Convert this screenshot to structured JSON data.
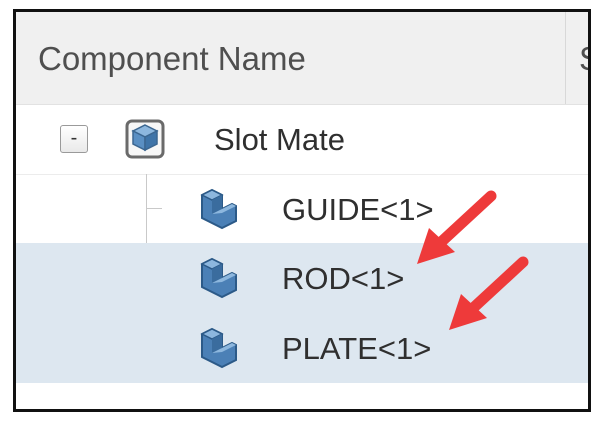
{
  "header": {
    "column_title": "Component Name",
    "next_column_title": "S"
  },
  "tree": {
    "root": {
      "toggle": "-",
      "label": "Slot Mate",
      "icon": "assembly-icon"
    },
    "children": [
      {
        "label": "GUIDE<1>",
        "icon": "part-icon"
      },
      {
        "label": "ROD<1>",
        "icon": "part-icon"
      },
      {
        "label": "PLATE<1>",
        "icon": "part-icon"
      }
    ]
  },
  "annotations": {
    "arrow_color": "#ee3a3a"
  },
  "colors": {
    "selected_row": "#dde7f0",
    "header_bg": "#f0f0f0",
    "part_icon_blue": "#4b80b6"
  }
}
